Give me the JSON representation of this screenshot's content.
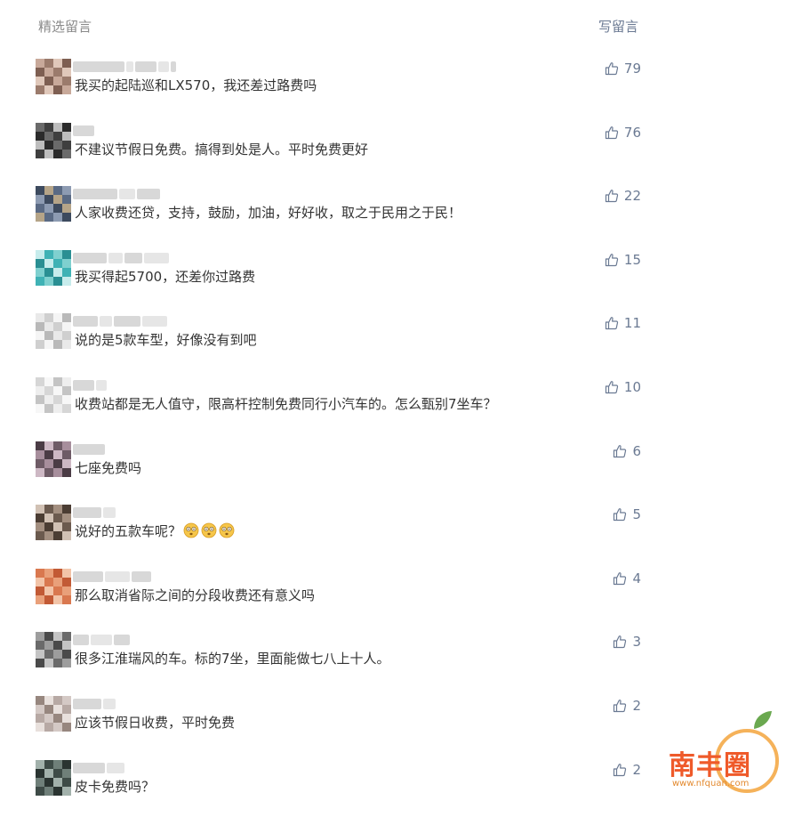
{
  "header": {
    "title": "精选留言",
    "write_label": "写留言"
  },
  "comments": [
    {
      "text": "我买的起陆巡和LX570，我还差过路费吗",
      "likes": "79",
      "avatar": [
        "#c8a99a",
        "#9b7b6c",
        "#e0c8ba",
        "#7e5f52"
      ]
    },
    {
      "text": "不建议节假日免费。搞得到处是人。平时免费更好",
      "likes": "76",
      "avatar": [
        "#2b2b2b",
        "#6a6a6a",
        "#3f3f3f",
        "#bdbdbd"
      ]
    },
    {
      "text": "人家收费还贷，支持，鼓励，加油，好好收，取之于民用之于民！",
      "likes": "22",
      "avatar": [
        "#5a6a84",
        "#8d9bb2",
        "#3d4a5e",
        "#b5a488"
      ]
    },
    {
      "text": "我买得起5700，还差你过路费",
      "likes": "15",
      "avatar": [
        "#3fb2b5",
        "#7fd0cf",
        "#2a8f93",
        "#c7ecec"
      ]
    },
    {
      "text": "说的是5款车型，好像没有到吧",
      "likes": "11",
      "avatar": [
        "#e9e9e9",
        "#cfcfcf",
        "#f5f5f5",
        "#b9b9b9"
      ]
    },
    {
      "text": "收费站都是无人值守，限高杆控制免费同行小汽车的。怎么甄别7坐车？",
      "likes": "10",
      "avatar": [
        "#eeeeee",
        "#d6d6d6",
        "#f7f7f7",
        "#c4c4c4"
      ]
    },
    {
      "text": "七座免费吗",
      "likes": "6",
      "avatar": [
        "#6e5b66",
        "#a78e9c",
        "#4b3c45",
        "#cdb8c4"
      ]
    },
    {
      "text": "说好的五款车呢？",
      "likes": "5",
      "avatar": [
        "#6b5a4e",
        "#a38f80",
        "#4b3d33",
        "#d1c1b4"
      ],
      "emojis": [
        "dizzy-face-icon",
        "dizzy-face-icon",
        "dizzy-face-icon"
      ]
    },
    {
      "text": "那么取消省际之间的分段收费还有意义吗",
      "likes": "4",
      "avatar": [
        "#d9784f",
        "#e9a07a",
        "#c25a35",
        "#f2c4a8"
      ]
    },
    {
      "text": "很多江淮瑞风的车。标的7坐，里面能做七八上十人。",
      "likes": "3",
      "avatar": [
        "#6a6a6a",
        "#9d9d9d",
        "#4a4a4a",
        "#c4c4c4"
      ]
    },
    {
      "text": "应该节假日收费，平时免费",
      "likes": "2",
      "avatar": [
        "#b7a9a4",
        "#d4c9c5",
        "#97877f",
        "#e8e0dc"
      ]
    },
    {
      "text": "皮卡免费吗？",
      "likes": "2",
      "avatar": [
        "#3e4b47",
        "#6f7f79",
        "#2a3431",
        "#a2b1ab"
      ]
    }
  ],
  "watermark": {
    "brand": "南丰圈",
    "url": "www.nfquan.com"
  },
  "colors": {
    "link": "#6b7a93",
    "text": "#333333",
    "muted": "#8a8a8a",
    "brand": "#ef5a2a"
  }
}
